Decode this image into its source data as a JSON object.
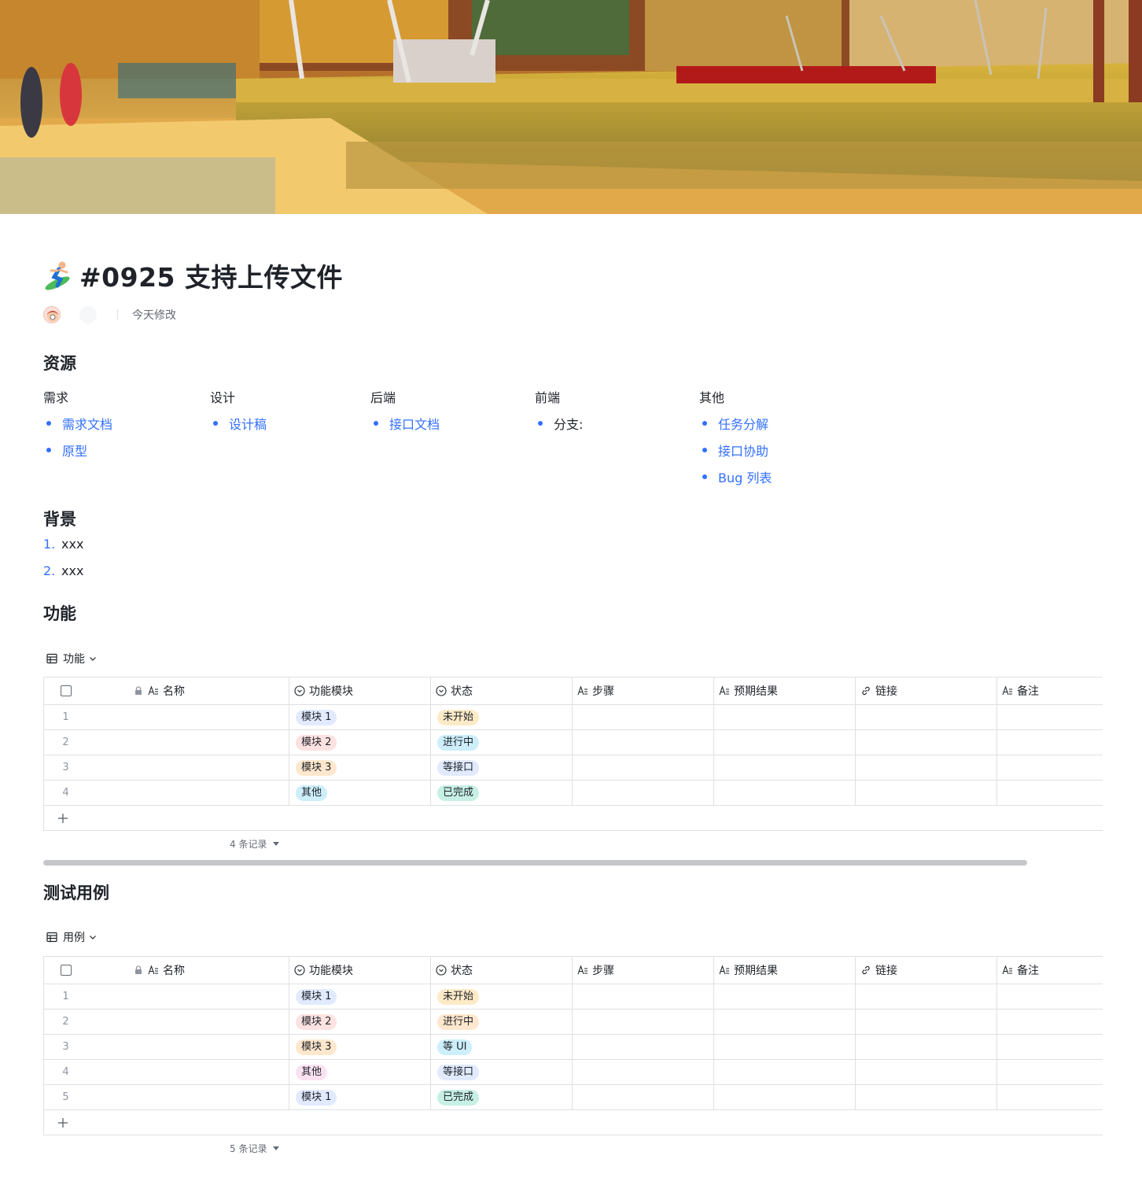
{
  "doc": {
    "title": "#0925 支持上传文件",
    "modified": "今天修改"
  },
  "sections": {
    "resources": "资源",
    "background": "背景",
    "features": "功能",
    "tests": "测试用例"
  },
  "resources": {
    "columns": [
      {
        "heading": "需求",
        "items": [
          {
            "text": "需求文档",
            "link": true
          },
          {
            "text": "原型",
            "link": true
          }
        ]
      },
      {
        "heading": "设计",
        "items": [
          {
            "text": "设计稿",
            "link": true
          }
        ]
      },
      {
        "heading": "后端",
        "items": [
          {
            "text": "接口文档",
            "link": true
          }
        ]
      },
      {
        "heading": "前端",
        "items": [
          {
            "text": "分支:",
            "link": false
          }
        ]
      },
      {
        "heading": "其他",
        "items": [
          {
            "text": "任务分解",
            "link": true
          },
          {
            "text": "接口协助",
            "link": true
          },
          {
            "text": "Bug 列表",
            "link": true
          }
        ]
      }
    ]
  },
  "background": {
    "items": [
      {
        "num": "1.",
        "text": "xxx"
      },
      {
        "num": "2.",
        "text": "xxx"
      }
    ]
  },
  "columns": {
    "name": "名称",
    "module": "功能模块",
    "status": "状态",
    "steps": "步骤",
    "expected": "预期结果",
    "link": "链接",
    "note": "备注"
  },
  "features_table": {
    "view": "功能",
    "records": "4 条记录",
    "rows": [
      {
        "idx": "1",
        "module": "模块 1",
        "module_color": "#e1eaff",
        "status": "未开始",
        "status_color": "#fdebc8"
      },
      {
        "idx": "2",
        "module": "模块 2",
        "module_color": "#fde2e2",
        "status": "进行中",
        "status_color": "#cdeefb"
      },
      {
        "idx": "3",
        "module": "模块 3",
        "module_color": "#fee7cd",
        "status": "等接口",
        "status_color": "#e1eaff"
      },
      {
        "idx": "4",
        "module": "其他",
        "module_color": "#cdeefb",
        "status": "已完成",
        "status_color": "#c7f0e5"
      }
    ]
  },
  "tests_table": {
    "view": "用例",
    "records": "5 条记录",
    "rows": [
      {
        "idx": "1",
        "module": "模块 1",
        "module_color": "#e1eaff",
        "status": "未开始",
        "status_color": "#fdebc8"
      },
      {
        "idx": "2",
        "module": "模块 2",
        "module_color": "#fde2e2",
        "status": "进行中",
        "status_color": "#fee7cd"
      },
      {
        "idx": "3",
        "module": "模块 3",
        "module_color": "#fee7cd",
        "status": "等 UI",
        "status_color": "#cdeefb"
      },
      {
        "idx": "4",
        "module": "其他",
        "module_color": "#fbe2f2",
        "status": "等接口",
        "status_color": "#e1eaff"
      },
      {
        "idx": "5",
        "module": "模块 1",
        "module_color": "#e1eaff",
        "status": "已完成",
        "status_color": "#c7f0e5"
      }
    ]
  },
  "colors": {
    "accent": "#3370ff",
    "border": "#dee0e3",
    "text": "#1f2329",
    "muted": "#646a73"
  }
}
